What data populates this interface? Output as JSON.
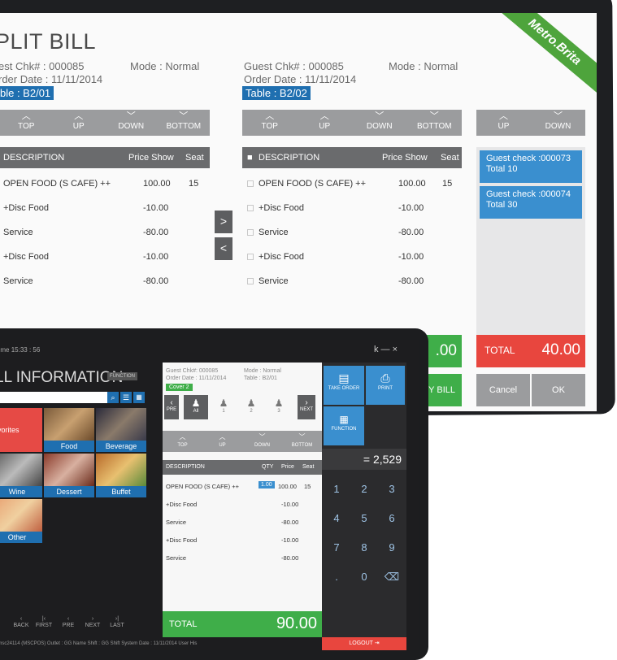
{
  "brand": "Metro.Brita",
  "split": {
    "title": "PLIT BILL",
    "left": {
      "guest": "est  Chk# : 000085",
      "mode": "Mode : Normal",
      "order_date": "rder Date : 11/11/2014",
      "table": "ble : B2/01"
    },
    "right": {
      "guest": "Guest  Chk# : 000085",
      "mode": "Mode : Normal",
      "order_date": "Order Date : 11/11/2014",
      "table": "Table : B2/02"
    },
    "nav": [
      "TOP",
      "UP",
      "DOWN",
      "BOTTOM"
    ],
    "nav_right": [
      "UP",
      "DOWN"
    ],
    "columns": {
      "desc": "DESCRIPTION",
      "price": "Price Show",
      "seat": "Seat"
    },
    "rows": [
      {
        "desc": "OPEN FOOD (S CAFE) ++",
        "price": "100.00",
        "seat": "15"
      },
      {
        "desc": "+Disc Food",
        "price": "-10.00",
        "seat": ""
      },
      {
        "desc": "Service",
        "price": "-80.00",
        "seat": ""
      },
      {
        "desc": "+Disc Food",
        "price": "-10.00",
        "seat": ""
      },
      {
        "desc": "Service",
        "price": "-80.00",
        "seat": ""
      }
    ],
    "rows_left_desc": [
      "OPEN FOOD (S CAFE) ++",
      "+Disc Food",
      "Service",
      "+Disc Food",
      "Service"
    ],
    "move_right": ">",
    "move_left": "<",
    "guest_checks": [
      {
        "line1": "Guest check :000073",
        "line2": "Total 10"
      },
      {
        "line1": "Guest check :000074",
        "line2": "Total 30"
      }
    ],
    "partial_total": ".00",
    "total_label": "TOTAL",
    "total_value": "40.00",
    "split_bill_btn": "Y BILL",
    "cancel": "Cancel",
    "ok": "OK",
    "colors": {
      "blue": "#3a8fcf",
      "green": "#3fae49",
      "red": "#e8463e",
      "gray": "#9b9c9e"
    }
  },
  "bill": {
    "time": "Time 15:33 : 56",
    "window_controls": "k — ×",
    "title": "LL INFORMATION",
    "function_tag": "FUNCTION",
    "categories": [
      {
        "label": "avorites"
      },
      {
        "label": "Food"
      },
      {
        "label": "Beverage"
      },
      {
        "label": "Wine"
      },
      {
        "label": "Dessert"
      },
      {
        "label": "Buffet"
      },
      {
        "label": "Other"
      }
    ],
    "guest_info": {
      "guest": "Guest  Chk#: 000085",
      "mode": "Mode : Normal",
      "order_date": "Order Date : 11/11/2014",
      "table": "Table : B2/01",
      "cover": "Cover 2"
    },
    "seat_labels": [
      "All",
      "1",
      "2",
      "3"
    ],
    "pre": "PRE",
    "next": "NEXT",
    "nav": [
      "TOP",
      "UP",
      "DOWN",
      "BOTTOM"
    ],
    "columns": {
      "desc": "DESCRIPTION",
      "qty": "QTY",
      "price": "Price",
      "seat": "Seat"
    },
    "rows": [
      {
        "desc": "OPEN FOOD (S CAFE) ++",
        "qty": "1.00",
        "price": "100.00",
        "seat": "15"
      },
      {
        "desc": "+Disc Food",
        "qty": "",
        "price": "-10.00",
        "seat": ""
      },
      {
        "desc": "Service",
        "qty": "",
        "price": "-80.00",
        "seat": ""
      },
      {
        "desc": "+Disc Food",
        "qty": "",
        "price": "-10.00",
        "seat": ""
      },
      {
        "desc": "Service",
        "qty": "",
        "price": "-80.00",
        "seat": ""
      }
    ],
    "total_label": "TOTAL",
    "total_value": "90.00",
    "take_order": "TAKE ORDER",
    "print": "PRINT",
    "function": "FUNCTION",
    "display": "= 2,529",
    "keys": [
      "1",
      "2",
      "3",
      "4",
      "5",
      "6",
      "7",
      "8",
      "9",
      ".",
      "0"
    ],
    "logout": "LOGOUT",
    "bottom_nav": [
      "P",
      "BACK",
      "FIRST",
      "PRE",
      "NEXT",
      "LAST"
    ],
    "status": "/ msc24114 (MSCPOS) Outlet : GG Name  Shift : GG Shift  System Date : 11/11/2014 User His"
  }
}
